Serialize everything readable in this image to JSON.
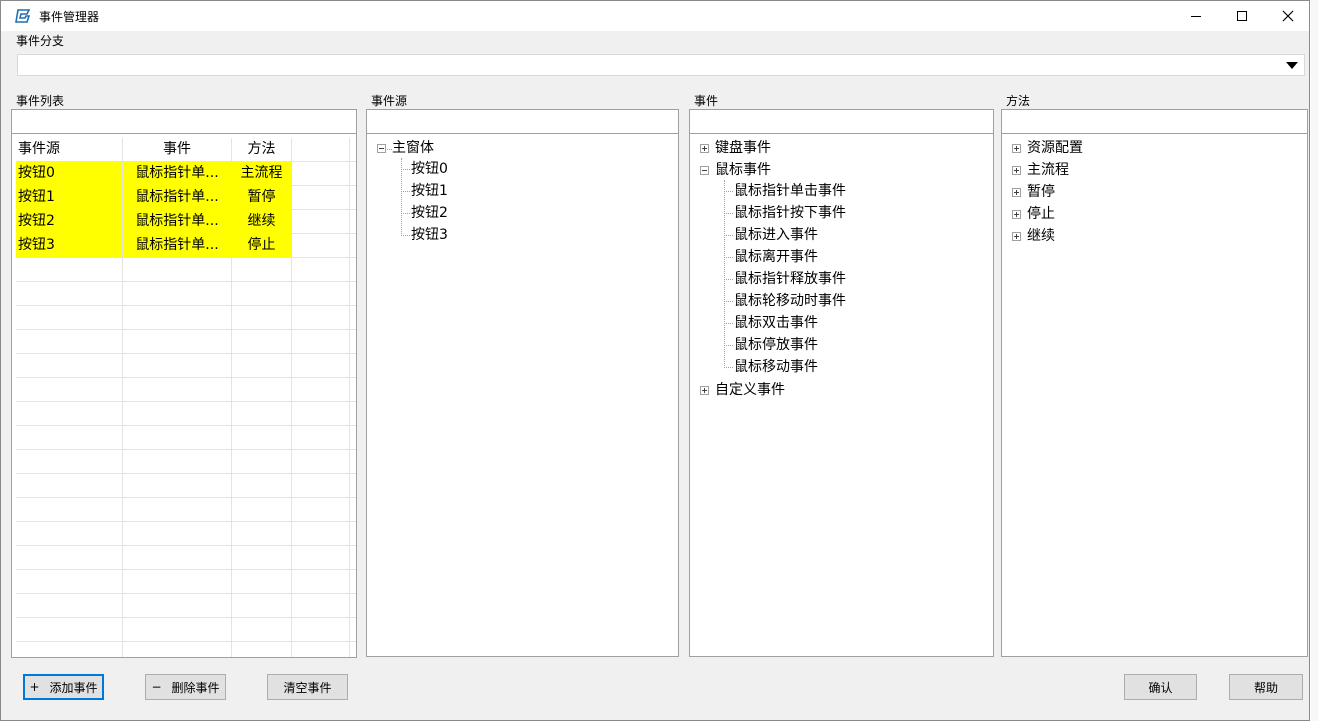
{
  "window": {
    "title": "事件管理器"
  },
  "branch": {
    "label": "事件分支",
    "value": ""
  },
  "event_list": {
    "label": "事件列表",
    "columns": [
      "事件源",
      "事件",
      "方法"
    ],
    "rows": [
      [
        "按钮0",
        "鼠标指针单...",
        "主流程"
      ],
      [
        "按钮1",
        "鼠标指针单...",
        "暂停"
      ],
      [
        "按钮2",
        "鼠标指针单...",
        "继续"
      ],
      [
        "按钮3",
        "鼠标指针单...",
        "停止"
      ]
    ]
  },
  "event_source": {
    "label": "事件源",
    "root": "主窗体",
    "children": [
      "按钮0",
      "按钮1",
      "按钮2",
      "按钮3"
    ]
  },
  "events": {
    "label": "事件",
    "keyboard": "键盘事件",
    "mouse": "鼠标事件",
    "mouse_children": [
      "鼠标指针单击事件",
      "鼠标指针按下事件",
      "鼠标进入事件",
      "鼠标离开事件",
      "鼠标指针释放事件",
      "鼠标轮移动时事件",
      "鼠标双击事件",
      "鼠标停放事件",
      "鼠标移动事件"
    ],
    "custom": "自定义事件"
  },
  "methods": {
    "label": "方法",
    "items": [
      "资源配置",
      "主流程",
      "暂停",
      "停止",
      "继续"
    ]
  },
  "buttons": {
    "add": "添加事件",
    "add_prefix": "+",
    "delete": "删除事件",
    "delete_prefix": "−",
    "clear": "清空事件",
    "confirm": "确认",
    "help": "帮助"
  },
  "icons": {
    "app": "app-logo-icon",
    "minimize": "minimize-icon",
    "maximize": "maximize-icon",
    "close": "close-icon",
    "dropdown": "dropdown-arrow-icon"
  },
  "colors": {
    "highlight": "#ffff00",
    "focus": "#0078d7"
  }
}
